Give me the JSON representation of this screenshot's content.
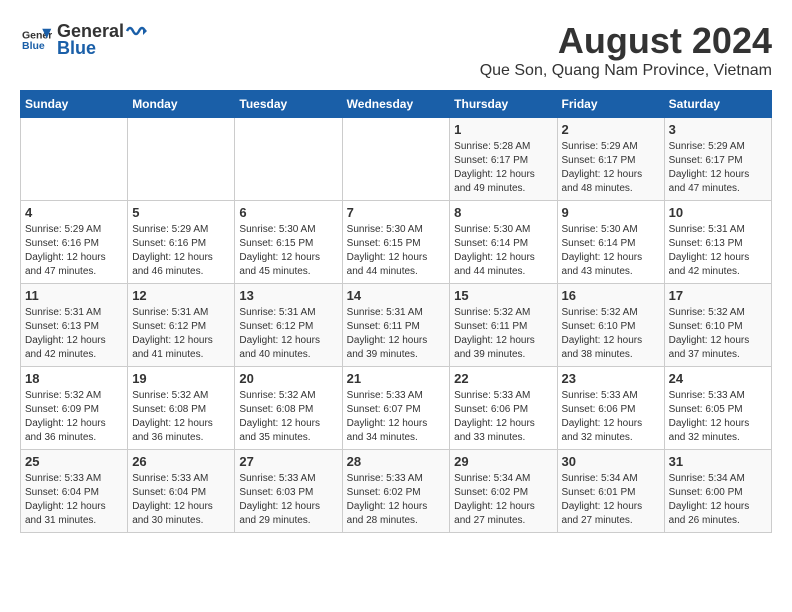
{
  "header": {
    "logo_general": "General",
    "logo_blue": "Blue",
    "month_title": "August 2024",
    "location": "Que Son, Quang Nam Province, Vietnam"
  },
  "days_of_week": [
    "Sunday",
    "Monday",
    "Tuesday",
    "Wednesday",
    "Thursday",
    "Friday",
    "Saturday"
  ],
  "weeks": [
    [
      {
        "day": "",
        "info": ""
      },
      {
        "day": "",
        "info": ""
      },
      {
        "day": "",
        "info": ""
      },
      {
        "day": "",
        "info": ""
      },
      {
        "day": "1",
        "info": "Sunrise: 5:28 AM\nSunset: 6:17 PM\nDaylight: 12 hours\nand 49 minutes."
      },
      {
        "day": "2",
        "info": "Sunrise: 5:29 AM\nSunset: 6:17 PM\nDaylight: 12 hours\nand 48 minutes."
      },
      {
        "day": "3",
        "info": "Sunrise: 5:29 AM\nSunset: 6:17 PM\nDaylight: 12 hours\nand 47 minutes."
      }
    ],
    [
      {
        "day": "4",
        "info": "Sunrise: 5:29 AM\nSunset: 6:16 PM\nDaylight: 12 hours\nand 47 minutes."
      },
      {
        "day": "5",
        "info": "Sunrise: 5:29 AM\nSunset: 6:16 PM\nDaylight: 12 hours\nand 46 minutes."
      },
      {
        "day": "6",
        "info": "Sunrise: 5:30 AM\nSunset: 6:15 PM\nDaylight: 12 hours\nand 45 minutes."
      },
      {
        "day": "7",
        "info": "Sunrise: 5:30 AM\nSunset: 6:15 PM\nDaylight: 12 hours\nand 44 minutes."
      },
      {
        "day": "8",
        "info": "Sunrise: 5:30 AM\nSunset: 6:14 PM\nDaylight: 12 hours\nand 44 minutes."
      },
      {
        "day": "9",
        "info": "Sunrise: 5:30 AM\nSunset: 6:14 PM\nDaylight: 12 hours\nand 43 minutes."
      },
      {
        "day": "10",
        "info": "Sunrise: 5:31 AM\nSunset: 6:13 PM\nDaylight: 12 hours\nand 42 minutes."
      }
    ],
    [
      {
        "day": "11",
        "info": "Sunrise: 5:31 AM\nSunset: 6:13 PM\nDaylight: 12 hours\nand 42 minutes."
      },
      {
        "day": "12",
        "info": "Sunrise: 5:31 AM\nSunset: 6:12 PM\nDaylight: 12 hours\nand 41 minutes."
      },
      {
        "day": "13",
        "info": "Sunrise: 5:31 AM\nSunset: 6:12 PM\nDaylight: 12 hours\nand 40 minutes."
      },
      {
        "day": "14",
        "info": "Sunrise: 5:31 AM\nSunset: 6:11 PM\nDaylight: 12 hours\nand 39 minutes."
      },
      {
        "day": "15",
        "info": "Sunrise: 5:32 AM\nSunset: 6:11 PM\nDaylight: 12 hours\nand 39 minutes."
      },
      {
        "day": "16",
        "info": "Sunrise: 5:32 AM\nSunset: 6:10 PM\nDaylight: 12 hours\nand 38 minutes."
      },
      {
        "day": "17",
        "info": "Sunrise: 5:32 AM\nSunset: 6:10 PM\nDaylight: 12 hours\nand 37 minutes."
      }
    ],
    [
      {
        "day": "18",
        "info": "Sunrise: 5:32 AM\nSunset: 6:09 PM\nDaylight: 12 hours\nand 36 minutes."
      },
      {
        "day": "19",
        "info": "Sunrise: 5:32 AM\nSunset: 6:08 PM\nDaylight: 12 hours\nand 36 minutes."
      },
      {
        "day": "20",
        "info": "Sunrise: 5:32 AM\nSunset: 6:08 PM\nDaylight: 12 hours\nand 35 minutes."
      },
      {
        "day": "21",
        "info": "Sunrise: 5:33 AM\nSunset: 6:07 PM\nDaylight: 12 hours\nand 34 minutes."
      },
      {
        "day": "22",
        "info": "Sunrise: 5:33 AM\nSunset: 6:06 PM\nDaylight: 12 hours\nand 33 minutes."
      },
      {
        "day": "23",
        "info": "Sunrise: 5:33 AM\nSunset: 6:06 PM\nDaylight: 12 hours\nand 32 minutes."
      },
      {
        "day": "24",
        "info": "Sunrise: 5:33 AM\nSunset: 6:05 PM\nDaylight: 12 hours\nand 32 minutes."
      }
    ],
    [
      {
        "day": "25",
        "info": "Sunrise: 5:33 AM\nSunset: 6:04 PM\nDaylight: 12 hours\nand 31 minutes."
      },
      {
        "day": "26",
        "info": "Sunrise: 5:33 AM\nSunset: 6:04 PM\nDaylight: 12 hours\nand 30 minutes."
      },
      {
        "day": "27",
        "info": "Sunrise: 5:33 AM\nSunset: 6:03 PM\nDaylight: 12 hours\nand 29 minutes."
      },
      {
        "day": "28",
        "info": "Sunrise: 5:33 AM\nSunset: 6:02 PM\nDaylight: 12 hours\nand 28 minutes."
      },
      {
        "day": "29",
        "info": "Sunrise: 5:34 AM\nSunset: 6:02 PM\nDaylight: 12 hours\nand 27 minutes."
      },
      {
        "day": "30",
        "info": "Sunrise: 5:34 AM\nSunset: 6:01 PM\nDaylight: 12 hours\nand 27 minutes."
      },
      {
        "day": "31",
        "info": "Sunrise: 5:34 AM\nSunset: 6:00 PM\nDaylight: 12 hours\nand 26 minutes."
      }
    ]
  ]
}
